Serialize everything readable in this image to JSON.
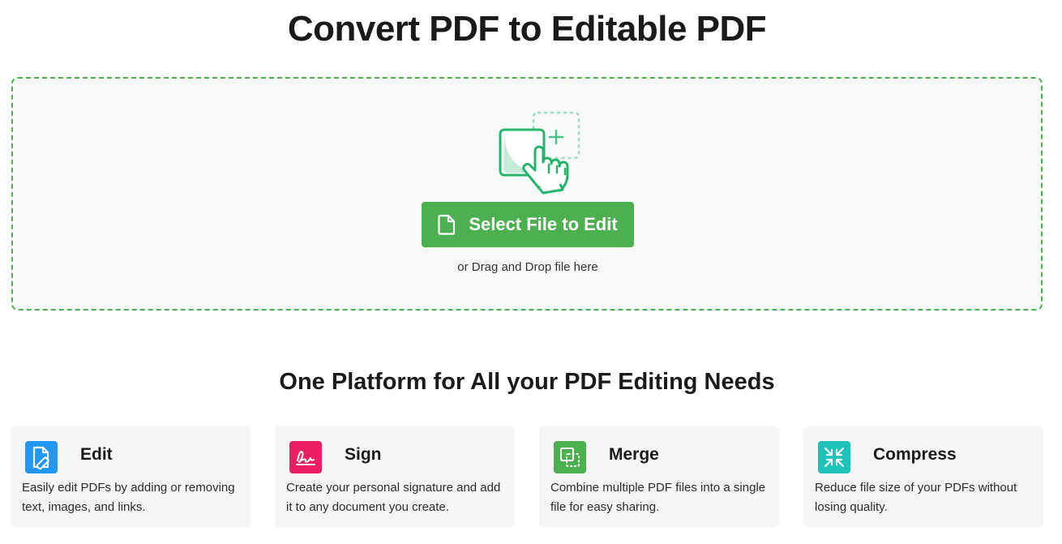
{
  "page": {
    "title": "Convert PDF to Editable PDF"
  },
  "dropzone": {
    "button_label": "Select File to Edit",
    "hint": "or Drag and Drop file here"
  },
  "features": {
    "heading": "One Platform for All your PDF Editing Needs",
    "items": [
      {
        "title": "Edit",
        "description": "Easily edit PDFs by adding or removing text, images, and links.",
        "icon": "edit-icon",
        "color": "#2196f3"
      },
      {
        "title": "Sign",
        "description": "Create your personal signature and add it to any document you create.",
        "icon": "signature-icon",
        "color": "#e91e63"
      },
      {
        "title": "Merge",
        "description": "Combine multiple PDF files into a single file for easy sharing.",
        "icon": "merge-icon",
        "color": "#4caf50"
      },
      {
        "title": "Compress",
        "description": "Reduce file size of your PDFs without losing quality.",
        "icon": "compress-icon",
        "color": "#1ec2b8"
      }
    ]
  },
  "colors": {
    "accent": "#4caf50",
    "dropzone_border": "#4caf50",
    "dropzone_bg": "#f8f9f9",
    "card_bg": "#f6f6f6"
  }
}
